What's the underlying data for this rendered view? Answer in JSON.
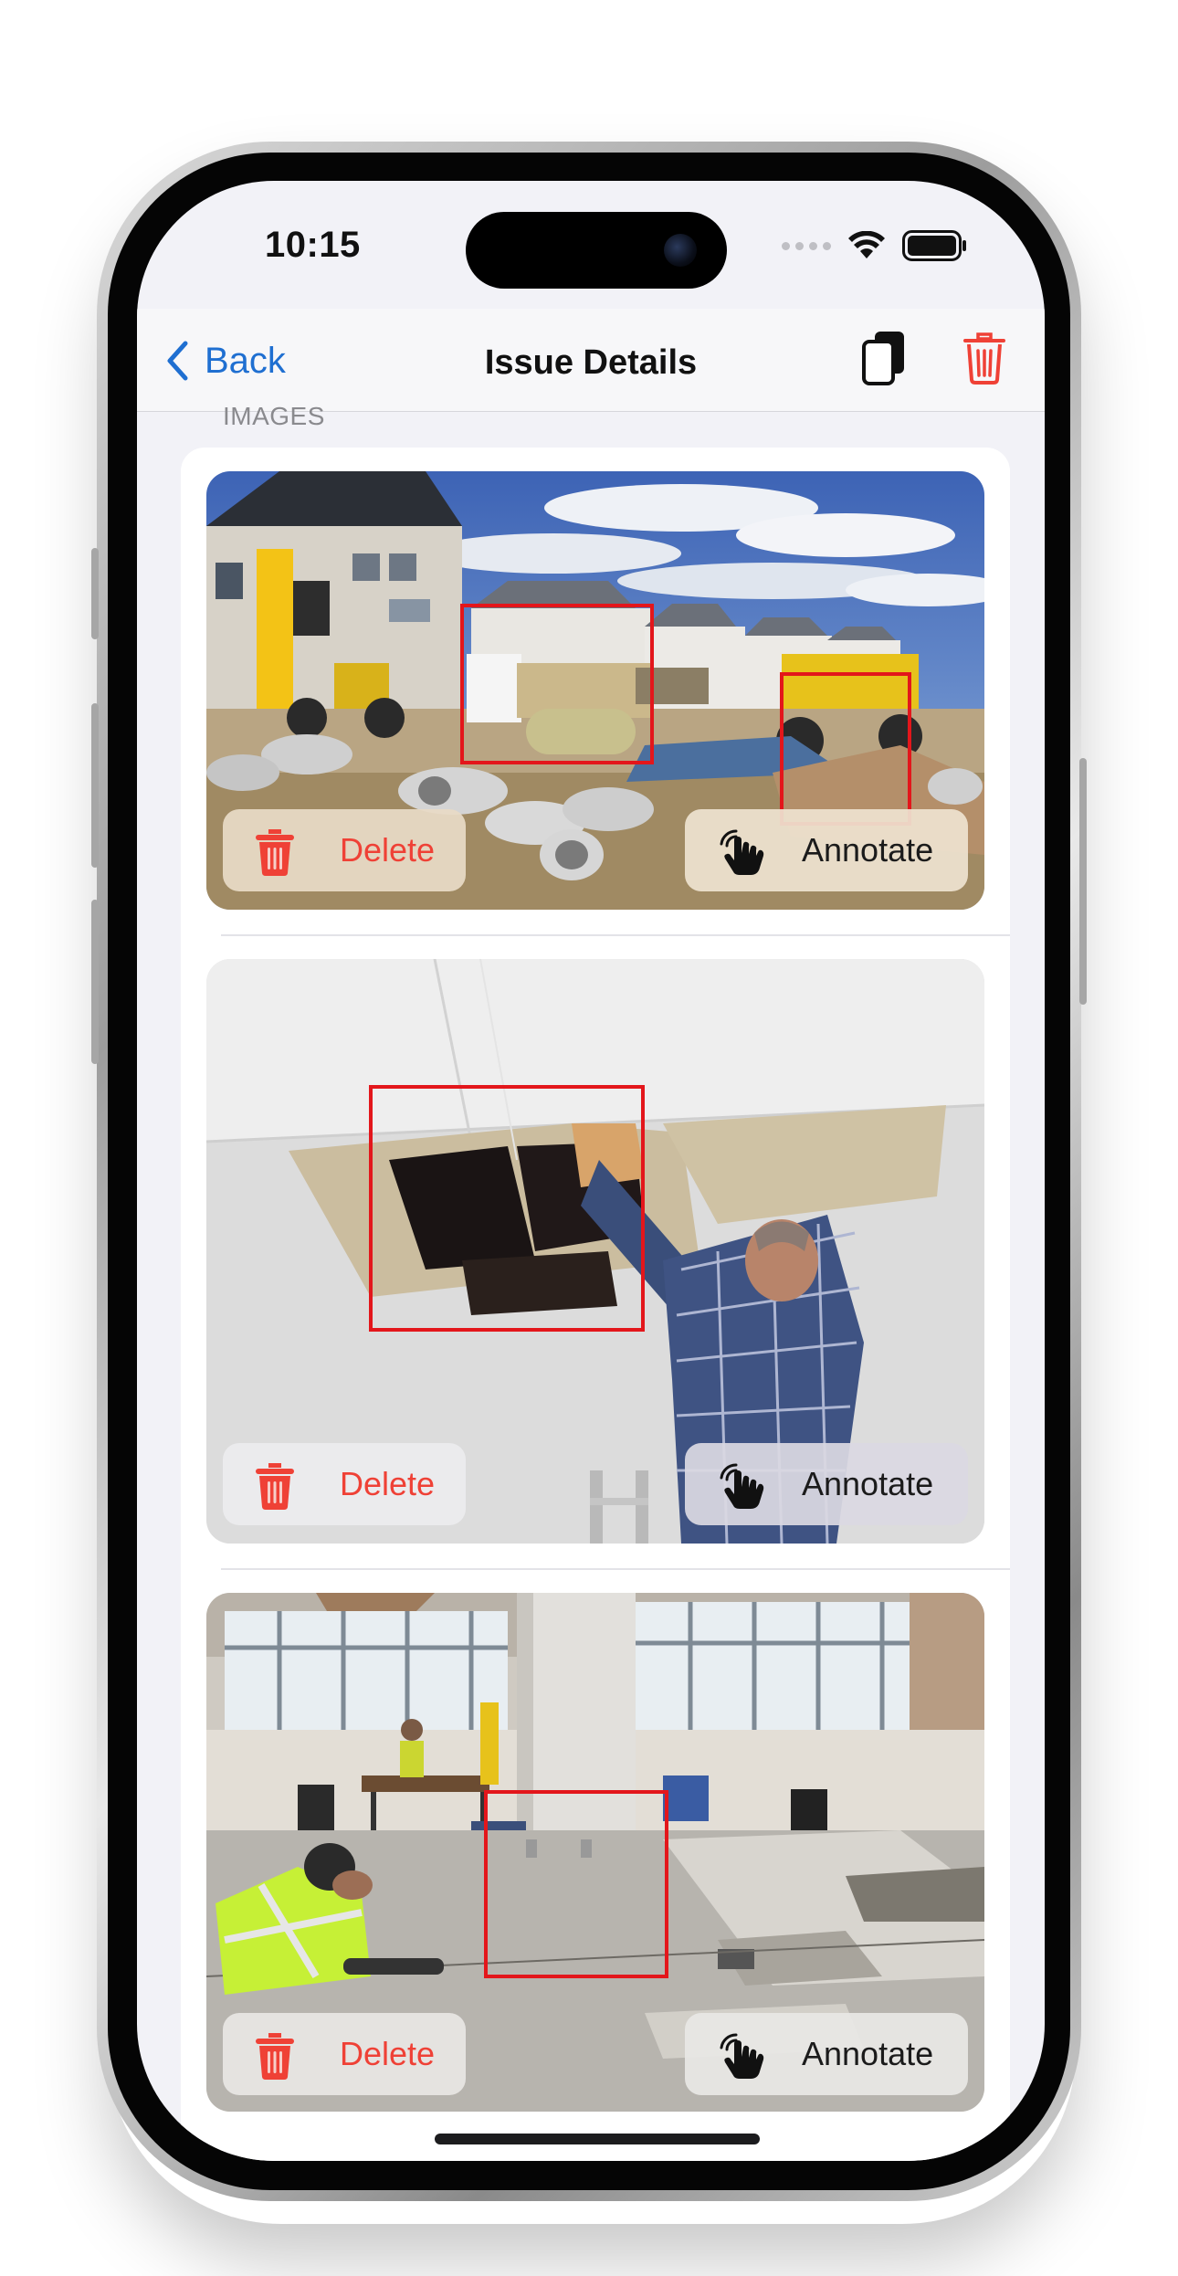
{
  "status_bar": {
    "time": "10:15"
  },
  "nav": {
    "back_label": "Back",
    "title": "Issue Details",
    "copy_icon": "copy-icon",
    "delete_icon": "trash-icon"
  },
  "section": {
    "label": "IMAGES"
  },
  "images": [
    {
      "description": "construction site",
      "delete_label": "Delete",
      "annotate_label": "Annotate"
    },
    {
      "description": "damaged ceiling",
      "delete_label": "Delete",
      "annotate_label": "Annotate"
    },
    {
      "description": "office floor",
      "delete_label": "Delete",
      "annotate_label": "Annotate"
    }
  ],
  "colors": {
    "accent_blue": "#1f6fd1",
    "destructive_red": "#ef4136",
    "annotation_box": "#e3161b",
    "background": "#f2f2f7"
  }
}
